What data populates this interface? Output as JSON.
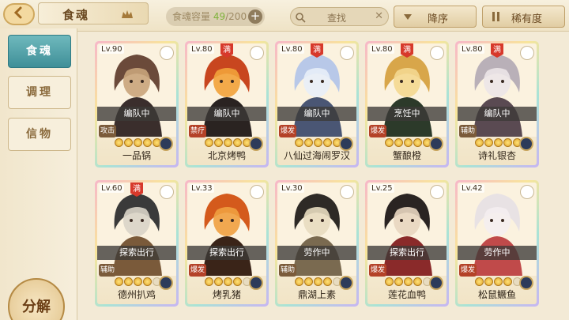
{
  "header": {
    "title": "食魂",
    "capacity_label": "食魂容量",
    "capacity_current": "49",
    "capacity_max": "/200",
    "capacity_plus": "+",
    "search_placeholder": "查找",
    "sort_label": "降序",
    "rarity_label": "稀有度"
  },
  "sidebar": {
    "tabs": [
      {
        "label": "食魂",
        "active": true
      },
      {
        "label": "调理",
        "active": false
      },
      {
        "label": "信物",
        "active": false
      }
    ],
    "decompose_label": "分解"
  },
  "cards": [
    {
      "level": "Lv.90",
      "full": "",
      "status": "编队中",
      "role": "攻击",
      "stars": 5,
      "name": "一品锅",
      "colors": [
        "#6b4a3a",
        "#c9a47b",
        "#3a2e2c"
      ]
    },
    {
      "level": "Lv.80",
      "full": "满",
      "status": "编队中",
      "role": "禁疗",
      "stars": 5,
      "name": "北京烤鸭",
      "colors": [
        "#c8461f",
        "#f2a23a",
        "#2a2321"
      ]
    },
    {
      "level": "Lv.80",
      "full": "满",
      "status": "编队中",
      "role": "爆发",
      "stars": 5,
      "name": "八仙过海闹罗汉",
      "colors": [
        "#b8c8e8",
        "#e8eef8",
        "#4a5674"
      ]
    },
    {
      "level": "Lv.80",
      "full": "满",
      "status": "烹饪中",
      "role": "爆发",
      "stars": 5,
      "name": "蟹酿橙",
      "colors": [
        "#d8a64a",
        "#f4d890",
        "#2c3a2a"
      ]
    },
    {
      "level": "Lv.80",
      "full": "满",
      "status": "编队中",
      "role": "辅助",
      "stars": 5,
      "name": "诗礼银杏",
      "colors": [
        "#b9b0b8",
        "#ece6e8",
        "#5a4a52"
      ]
    },
    {
      "level": "Lv.60",
      "full": "满",
      "status": "探索出行",
      "role": "辅助",
      "stars": 4,
      "name": "德州扒鸡",
      "colors": [
        "#3a3a3a",
        "#d9d4c8",
        "#7a5a3a"
      ]
    },
    {
      "level": "Lv.33",
      "full": "",
      "status": "探索出行",
      "role": "爆发",
      "stars": 4,
      "name": "烤乳猪",
      "colors": [
        "#d45a1c",
        "#f0a040",
        "#3a2418"
      ]
    },
    {
      "level": "Lv.30",
      "full": "",
      "status": "劳作中",
      "role": "辅助",
      "stars": 4,
      "name": "鼎湖上素",
      "colors": [
        "#2e2a26",
        "#e8dcc0",
        "#7a6a50"
      ]
    },
    {
      "level": "Lv.25",
      "full": "",
      "status": "探索出行",
      "role": "爆发",
      "stars": 4,
      "name": "莲花血鸭",
      "colors": [
        "#2a2422",
        "#e8d6c0",
        "#8a2a2a"
      ]
    },
    {
      "level": "Lv.42",
      "full": "",
      "status": "劳作中",
      "role": "爆发",
      "stars": 4,
      "name": "松鼠鳜鱼",
      "colors": [
        "#e8e2e4",
        "#f4eef0",
        "#c04a4a"
      ]
    }
  ]
}
